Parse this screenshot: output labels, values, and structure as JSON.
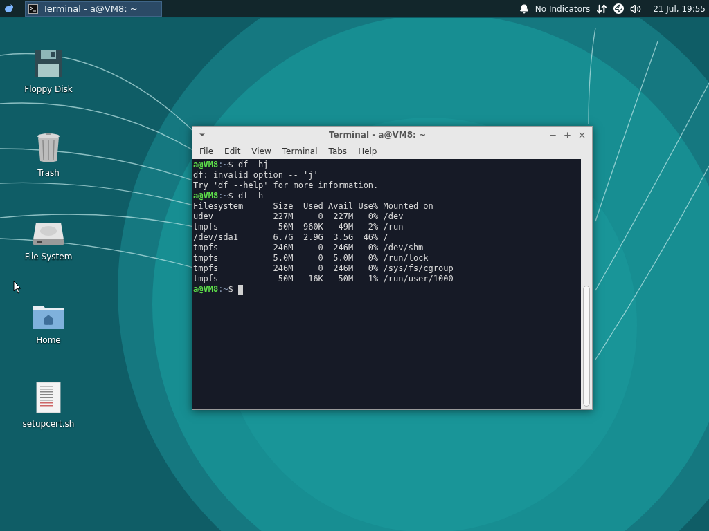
{
  "panel": {
    "task": {
      "title": "Terminal - a@VM8: ~",
      "selected": true
    },
    "indicator": "No Indicators",
    "clock": "21 Jul, 19:55"
  },
  "desktop_icons": [
    {
      "kind": "floppy",
      "label": "Floppy Disk"
    },
    {
      "kind": "trash",
      "label": "Trash"
    },
    {
      "kind": "drive",
      "label": "File System"
    },
    {
      "kind": "folder",
      "label": "Home"
    },
    {
      "kind": "script",
      "label": "setupcert.sh"
    }
  ],
  "window": {
    "title": "Terminal - a@VM8: ~",
    "menu": [
      "File",
      "Edit",
      "View",
      "Terminal",
      "Tabs",
      "Help"
    ],
    "lines": [
      {
        "kind": "prompt",
        "user": "a@VM8",
        "path": ":~",
        "sign": "$",
        "command": " df -hj",
        "cursor": false
      },
      {
        "kind": "output",
        "text": "df: invalid option -- 'j'"
      },
      {
        "kind": "output",
        "text": "Try 'df --help' for more information."
      },
      {
        "kind": "prompt",
        "user": "a@VM8",
        "path": ":~",
        "sign": "$",
        "command": " df -h",
        "cursor": false
      },
      {
        "kind": "output",
        "text": "Filesystem      Size  Used Avail Use% Mounted on"
      },
      {
        "kind": "output",
        "text": "udev            227M     0  227M   0% /dev"
      },
      {
        "kind": "output",
        "text": "tmpfs            50M  960K   49M   2% /run"
      },
      {
        "kind": "output",
        "text": "/dev/sda1       6.7G  2.9G  3.5G  46% /"
      },
      {
        "kind": "output",
        "text": "tmpfs           246M     0  246M   0% /dev/shm"
      },
      {
        "kind": "output",
        "text": "tmpfs           5.0M     0  5.0M   0% /run/lock"
      },
      {
        "kind": "output",
        "text": "tmpfs           246M     0  246M   0% /sys/fs/cgroup"
      },
      {
        "kind": "output",
        "text": "tmpfs            50M   16K   50M   1% /run/user/1000"
      },
      {
        "kind": "prompt",
        "user": "a@VM8",
        "path": ":~",
        "sign": "$",
        "cursor": true
      }
    ]
  }
}
